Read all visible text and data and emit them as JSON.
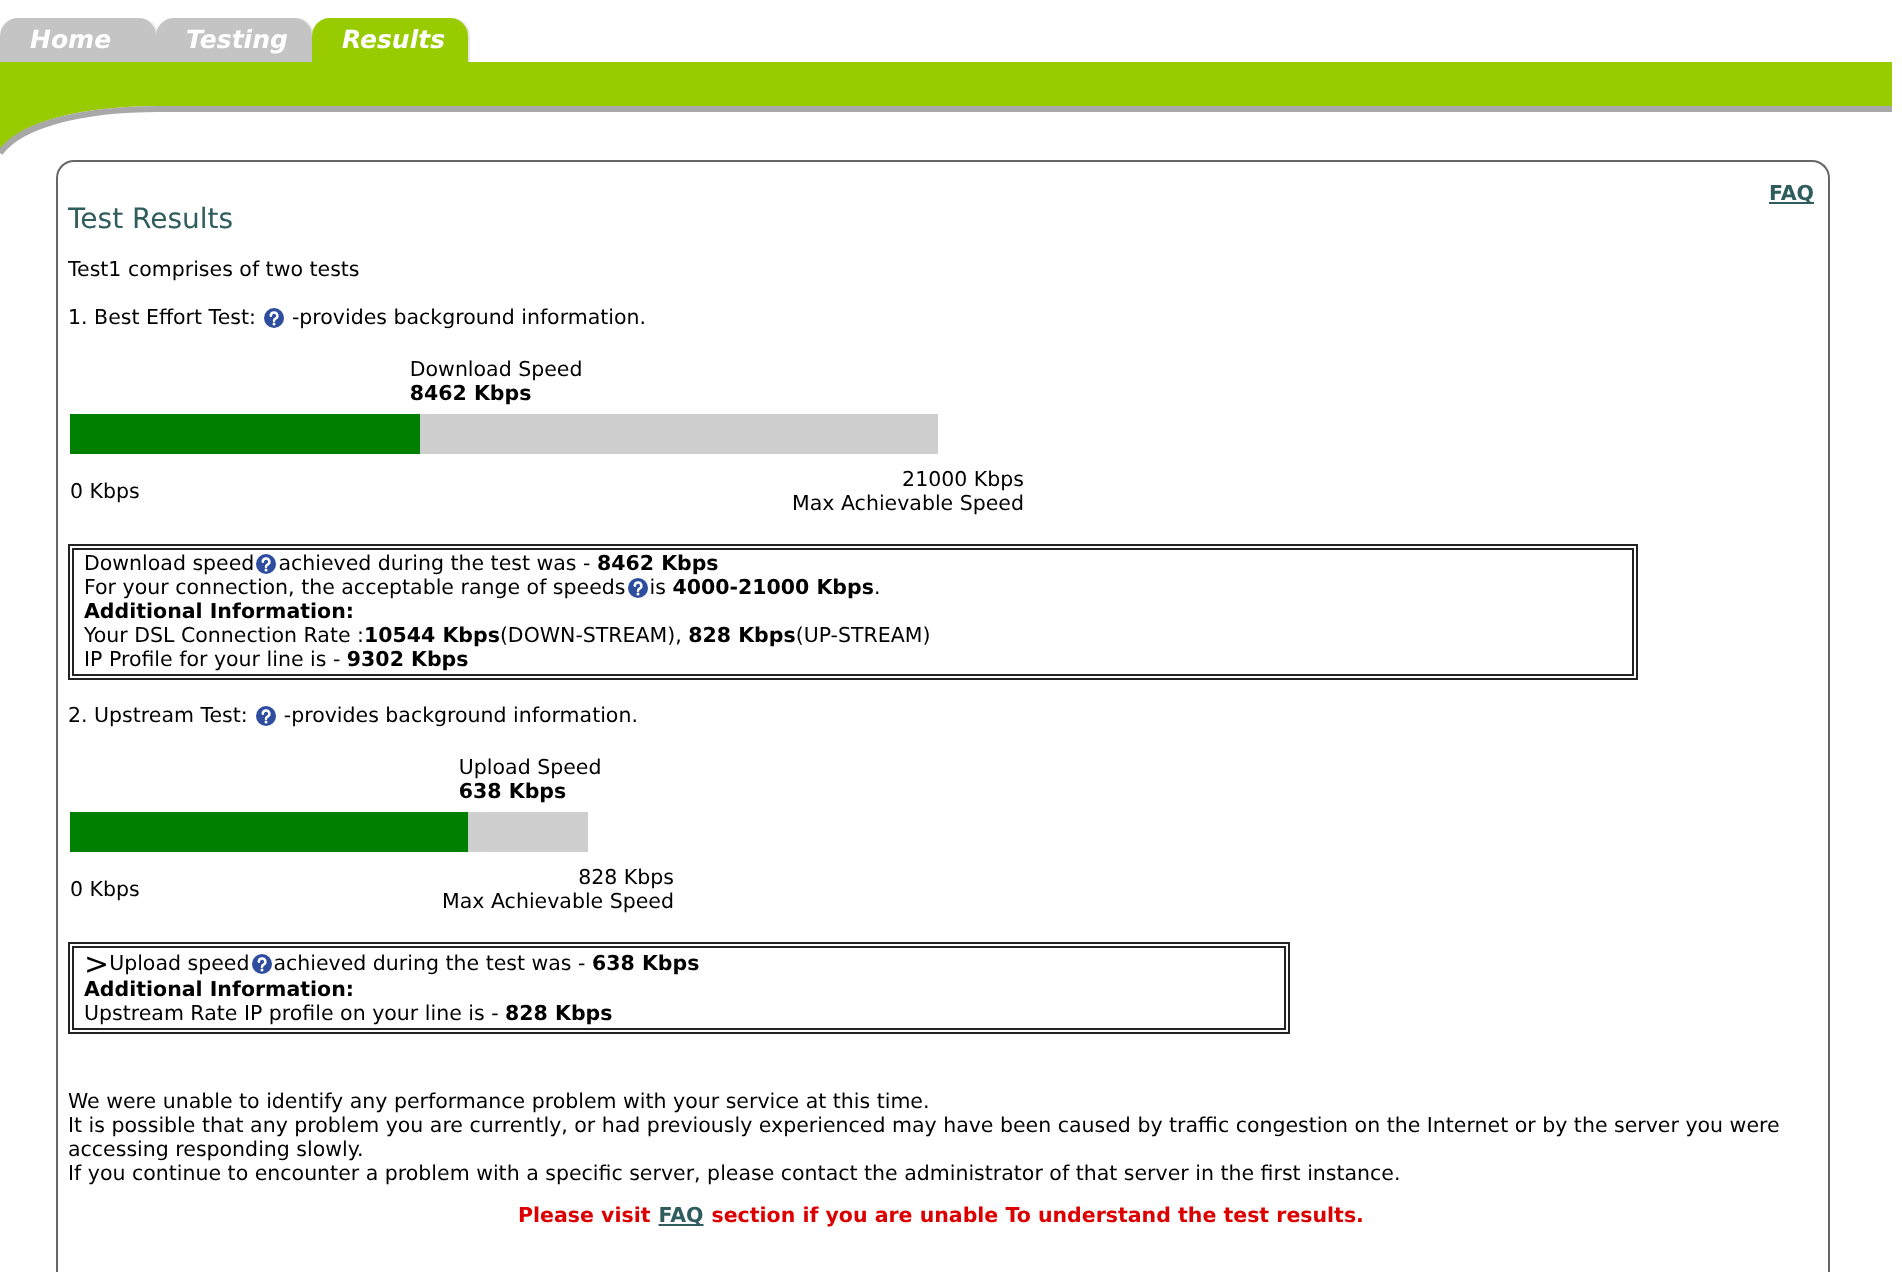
{
  "tabs": [
    {
      "label": "Home",
      "selected": false
    },
    {
      "label": "Testing",
      "selected": false
    },
    {
      "label": "Results",
      "selected": true
    }
  ],
  "header": {
    "title": "Test Results",
    "faq_link": "FAQ"
  },
  "intro": "Test1 comprises of two tests",
  "tests": [
    {
      "title": "1. Best Effort Test:",
      "help": true,
      "note": "-provides background information.",
      "meter": {
        "label": "Download Speed",
        "value": "8462 Kbps",
        "level": 0.403,
        "min_label": "0 Kbps",
        "max_label": "21000 Kbps",
        "max_caption": "Max Achievable Speed"
      },
      "details": [
        {
          "kind": "text",
          "lead": "Download speed",
          "help": true,
          "text": "achieved during the test was - **8462 Kbps**"
        },
        {
          "kind": "text",
          "lead": "For your connection, the acceptable range of speeds",
          "help": true,
          "text": "is **4000-21000 Kbps**."
        },
        {
          "kind": "heading",
          "help": false,
          "text": "Additional Information:"
        },
        {
          "kind": "text",
          "help": false,
          "text": "Your DSL Connection Rate :**10544 Kbps**(DOWN-STREAM), **828 Kbps**(UP-STREAM)"
        },
        {
          "kind": "text",
          "help": false,
          "text": "IP Profile for your line is - **9302 Kbps**"
        }
      ]
    },
    {
      "title": "2. Upstream Test:",
      "help": true,
      "note": "-provides background information.",
      "meter": {
        "label": "Upload Speed",
        "value": "638 Kbps",
        "level": 0.77,
        "min_label": "0 Kbps",
        "max_label": "828 Kbps",
        "max_caption": "Max Achievable Speed"
      },
      "details": [
        {
          "kind": "text",
          "marker": ">",
          "lead": "Upload speed",
          "help": true,
          "text": "achieved during the test was - **638 Kbps**"
        },
        {
          "kind": "heading",
          "help": false,
          "text": "Additional Information:"
        },
        {
          "kind": "text",
          "help": false,
          "text": "Upstream Rate IP profile on your line is - **828 Kbps**"
        }
      ]
    }
  ],
  "summary": [
    "We were unable to identify any performance problem with your service at this time.",
    "It is possible that any problem you are currently, or had previously experienced may have been caused by traffic congestion on the Internet or by the server you were accessing responding slowly.",
    "If you continue to encounter a problem with a specific server, please contact the administrator of that server in the first instance."
  ],
  "notice": {
    "before": "Please visit",
    "link": "FAQ",
    "after": "section if you are unable To understand the test results."
  }
}
